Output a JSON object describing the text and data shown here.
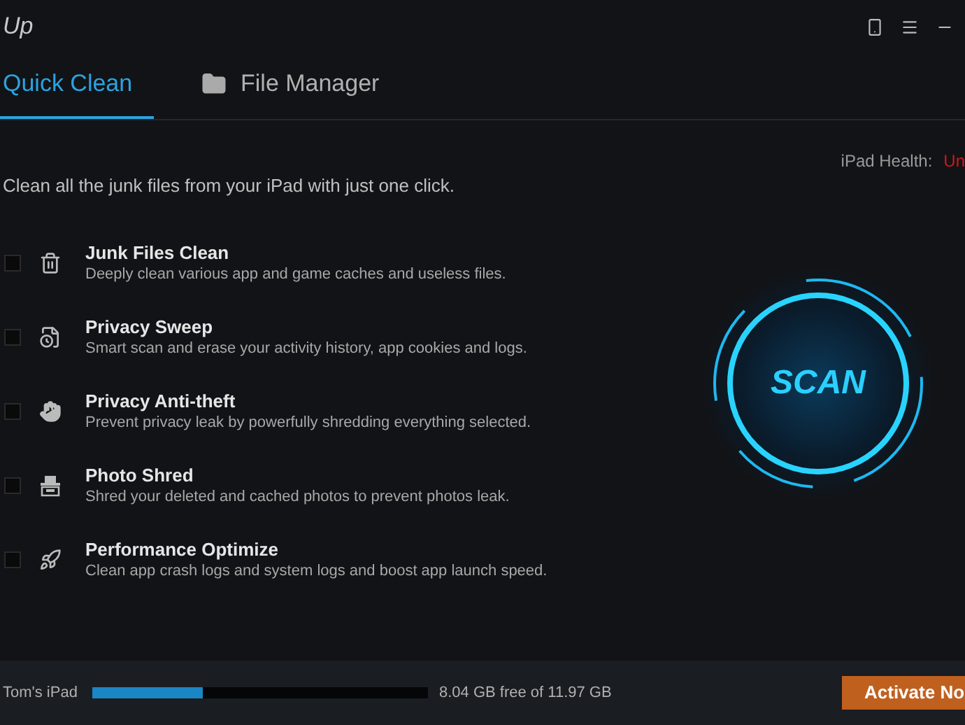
{
  "window": {
    "title": "Up"
  },
  "tabs": [
    {
      "label": "Quick Clean",
      "selected": true,
      "kind": "plain"
    },
    {
      "label": "File Manager",
      "selected": false,
      "kind": "folder"
    }
  ],
  "health": {
    "label": "iPad Health:",
    "value": "Un"
  },
  "intro": "Clean all the junk files from your iPad with just one click.",
  "items": [
    {
      "kind": "trash",
      "title": "Junk Files Clean",
      "description": "Deeply clean various app and game caches and useless files.",
      "checked": false
    },
    {
      "kind": "log",
      "title": "Privacy Sweep",
      "description": "Smart scan and erase your activity history, app cookies and logs.",
      "checked": false
    },
    {
      "kind": "hand",
      "title": "Privacy Anti-theft",
      "description": "Prevent privacy leak by powerfully shredding everything selected.",
      "checked": false
    },
    {
      "kind": "shred",
      "title": "Photo Shred",
      "description": "Shred your deleted and cached photos to prevent photos leak.",
      "checked": false
    },
    {
      "kind": "rocket",
      "title": "Performance Optimize",
      "description": "Clean app crash logs and system logs and boost app launch speed.",
      "checked": false
    }
  ],
  "scan_button": "SCAN",
  "status_bar": {
    "device": "Tom's iPad",
    "level": 0.33,
    "storage": "8.04 GB free of 11.97 GB",
    "activate": "Activate No"
  }
}
